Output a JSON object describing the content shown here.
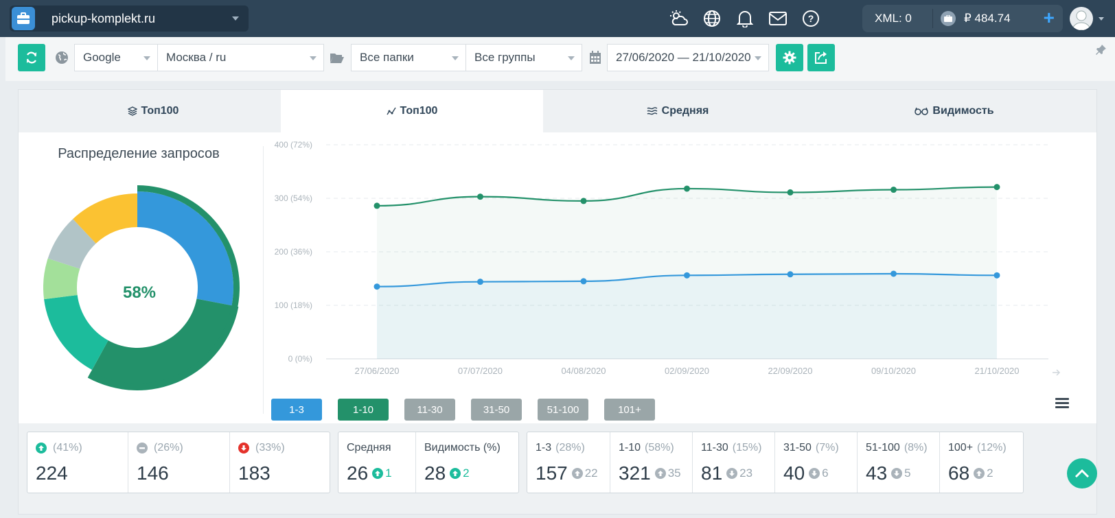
{
  "site": {
    "name": "pickup-komplekt.ru"
  },
  "topbar": {
    "xml_label": "XML: 0",
    "balance": "₽ 484.74",
    "plus": "+",
    "icons": [
      "weather-icon",
      "globe-icon",
      "bell-icon",
      "mail-icon",
      "help-icon"
    ]
  },
  "filters": {
    "engine": "Google",
    "region": "Москва / ru",
    "folders": "Все папки",
    "groups": "Все группы",
    "date_range": "27/06/2020 — 21/10/2020"
  },
  "tabs": [
    {
      "label": "Топ100",
      "icon": "layers-icon"
    },
    {
      "label": "Топ100",
      "icon": "line-chart-icon",
      "active": true
    },
    {
      "label": "Средняя",
      "icon": "waves-icon"
    },
    {
      "label": "Видимость",
      "icon": "glasses-icon"
    }
  ],
  "donut": {
    "title": "Распределение запросов",
    "center_label": "58%",
    "segments": [
      {
        "value": 28,
        "color": "#3498db"
      },
      {
        "value": 30,
        "color": "#23916a"
      },
      {
        "value": 15,
        "color": "#1cbc9c"
      },
      {
        "value": 7,
        "color": "#a3e09a"
      },
      {
        "value": 8,
        "color": "#b1c4c7"
      },
      {
        "value": 12,
        "color": "#fbc232"
      }
    ]
  },
  "chart_data": {
    "type": "area",
    "x": [
      "27/06/2020",
      "07/07/2020",
      "04/08/2020",
      "02/09/2020",
      "22/09/2020",
      "09/10/2020",
      "21/10/2020"
    ],
    "yticks": [
      "0 (0%)",
      "100 (18%)",
      "200 (36%)",
      "300 (54%)",
      "400 (72%)"
    ],
    "ylim": [
      0,
      400
    ],
    "series": [
      {
        "color": "#23916a",
        "values": [
          286,
          303,
          295,
          318,
          311,
          316,
          321
        ]
      },
      {
        "color": "#3498db",
        "values": [
          135,
          144,
          145,
          156,
          158,
          159,
          156
        ]
      }
    ]
  },
  "range_buttons": [
    {
      "label": "1-3",
      "color": "#3498db"
    },
    {
      "label": "1-10",
      "color": "#23916a"
    },
    {
      "label": "11-30",
      "color": "#9aa6a8"
    },
    {
      "label": "31-50",
      "color": "#9aa6a8"
    },
    {
      "label": "51-100",
      "color": "#9aa6a8"
    },
    {
      "label": "101+",
      "color": "#9aa6a8"
    }
  ],
  "stats": {
    "movement": [
      {
        "pct": "(41%)",
        "value": "224",
        "icon": "arrow-up-circle-icon"
      },
      {
        "pct": "(26%)",
        "value": "146",
        "icon": "minus-circle-icon"
      },
      {
        "pct": "(33%)",
        "value": "183",
        "icon": "arrow-down-circle-icon"
      }
    ],
    "avg": {
      "label": "Средняя",
      "value": "26",
      "delta": "1"
    },
    "visibility": {
      "label": "Видимость (%)",
      "value": "28",
      "delta": "2"
    },
    "ranges": [
      {
        "label": "1-3",
        "pct": "(28%)",
        "value": "157",
        "delta": "22",
        "dir": "up"
      },
      {
        "label": "1-10",
        "pct": "(58%)",
        "value": "321",
        "delta": "35",
        "dir": "up"
      },
      {
        "label": "11-30",
        "pct": "(15%)",
        "value": "81",
        "delta": "23",
        "dir": "down"
      },
      {
        "label": "31-50",
        "pct": "(7%)",
        "value": "40",
        "delta": "6",
        "dir": "down"
      },
      {
        "label": "51-100",
        "pct": "(8%)",
        "value": "43",
        "delta": "5",
        "dir": "down"
      },
      {
        "label": "100+",
        "pct": "(12%)",
        "value": "68",
        "delta": "2",
        "dir": "up"
      }
    ]
  }
}
